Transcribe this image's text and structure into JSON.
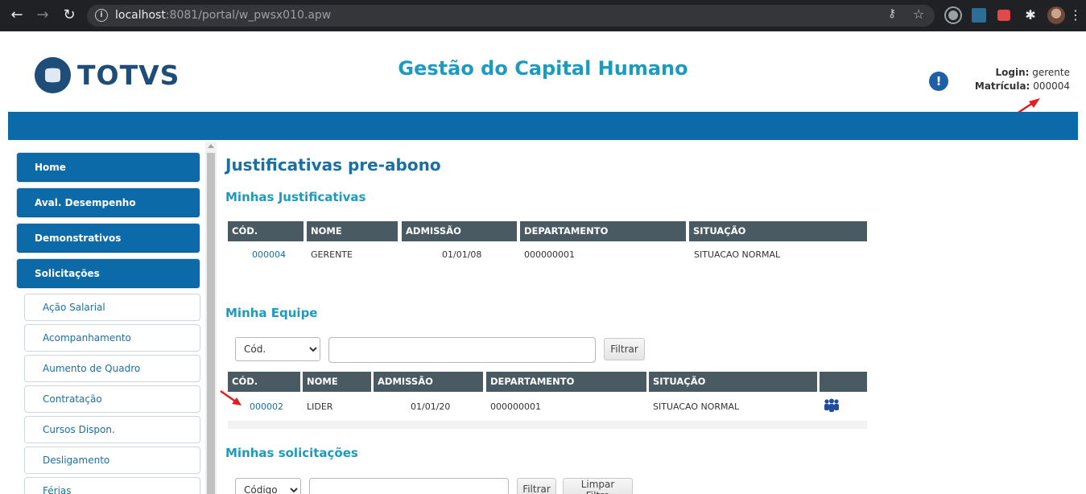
{
  "browser": {
    "url_host": "localhost",
    "url_rest": ":8081/portal/w_pwsx010.apw"
  },
  "header": {
    "logo_text": "TOTVS",
    "app_title": "Gestão do Capital Humano",
    "alert_glyph": "!",
    "login_label": "Login:",
    "login_value": "gerente",
    "matricula_label": "Matrícula:",
    "matricula_value": "000004"
  },
  "sidebar": {
    "main_items": [
      {
        "label": "Home"
      },
      {
        "label": "Aval. Desempenho"
      },
      {
        "label": "Demonstrativos"
      },
      {
        "label": "Solicitações"
      }
    ],
    "sub_items": [
      {
        "label": "Ação Salarial"
      },
      {
        "label": "Acompanhamento"
      },
      {
        "label": "Aumento de Quadro"
      },
      {
        "label": "Contratação"
      },
      {
        "label": "Cursos Dispon."
      },
      {
        "label": "Desligamento"
      },
      {
        "label": "Férias"
      }
    ]
  },
  "main": {
    "page_title": "Justificativas pre-abono",
    "minhas_justificativas": {
      "title": "Minhas Justificativas",
      "columns": [
        "CÓD.",
        "NOME",
        "ADMISSÃO",
        "DEPARTAMENTO",
        "SITUAÇÃO"
      ],
      "row": {
        "cod": "000004",
        "nome": "GERENTE",
        "admissao": "01/01/08",
        "departamento": "000000001",
        "situacao": "SITUACAO NORMAL"
      }
    },
    "minha_equipe": {
      "title": "Minha Equipe",
      "filter_select": "Cód.",
      "filter_input": "",
      "filter_button": "Filtrar",
      "columns": [
        "CÓD.",
        "NOME",
        "ADMISSÃO",
        "DEPARTAMENTO",
        "SITUAÇÃO",
        ""
      ],
      "row": {
        "cod": "000002",
        "nome": "LIDER",
        "admissao": "01/01/20",
        "departamento": "000000001",
        "situacao": "SITUACAO NORMAL"
      }
    },
    "minhas_solicitacoes": {
      "title": "Minhas solicitações",
      "filter_select": "Código",
      "filter_input": "",
      "filter_button": "Filtrar",
      "clear_button": "Limpar Filtro"
    }
  },
  "colors": {
    "brand_blue": "#0d6aa9",
    "title_cyan": "#1a9bbf",
    "grid_header": "#4a5a62",
    "annotation_red": "#e02020"
  }
}
